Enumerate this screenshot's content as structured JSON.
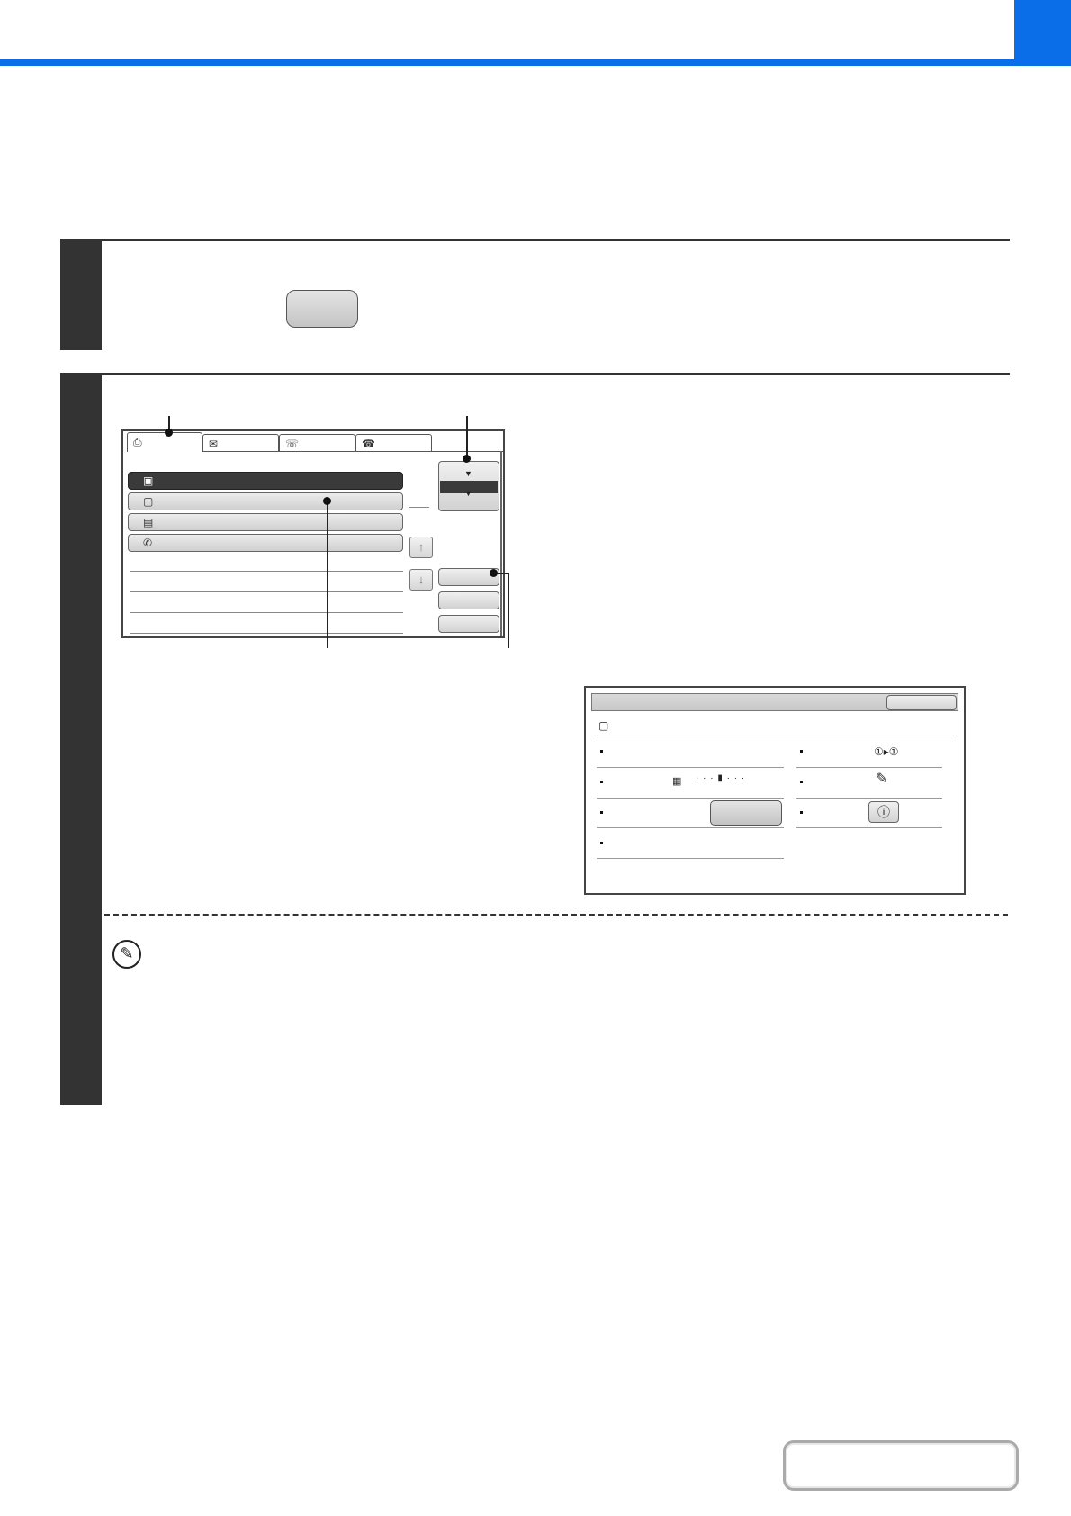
{
  "header": {
    "accent_color": "#0a6ee8"
  },
  "step1": {
    "button_label": ""
  },
  "step2": {
    "left_panel": {
      "tabs": [
        {
          "icon": "scanner-icon",
          "glyph": "⎙",
          "label": ""
        },
        {
          "icon": "email-icon",
          "glyph": "✉",
          "label": ""
        },
        {
          "icon": "fax-icon",
          "glyph": "☏",
          "label": ""
        },
        {
          "icon": "internet-fax-icon",
          "glyph": "☎",
          "label": ""
        }
      ],
      "list_items": [
        {
          "icon": "document-filing-icon",
          "glyph": "▣",
          "label": "",
          "selected": true
        },
        {
          "icon": "copy-job-icon",
          "glyph": "▢",
          "label": "",
          "selected": false
        },
        {
          "icon": "print-job-icon",
          "glyph": "▤",
          "label": "",
          "selected": false
        },
        {
          "icon": "fax-job-icon",
          "glyph": "✆",
          "label": "",
          "selected": false
        }
      ],
      "scroll_up_glyph": "↑",
      "scroll_down_glyph": "↓",
      "sort_glyphs": {
        "up": "▼",
        "down": "▼"
      }
    },
    "right_panel": {
      "title": "",
      "header_icon": "copy-job-icon",
      "header_glyph": "▢",
      "meter_glyph": "▦",
      "meter_dots": "· · · ▮ · · ·",
      "duplex_glyph": "①▸①",
      "special_modes_glyph": "✎",
      "info_glyph": "ⓘ"
    }
  },
  "note": {
    "icon": "pencil-note-icon",
    "glyph": "✎"
  }
}
